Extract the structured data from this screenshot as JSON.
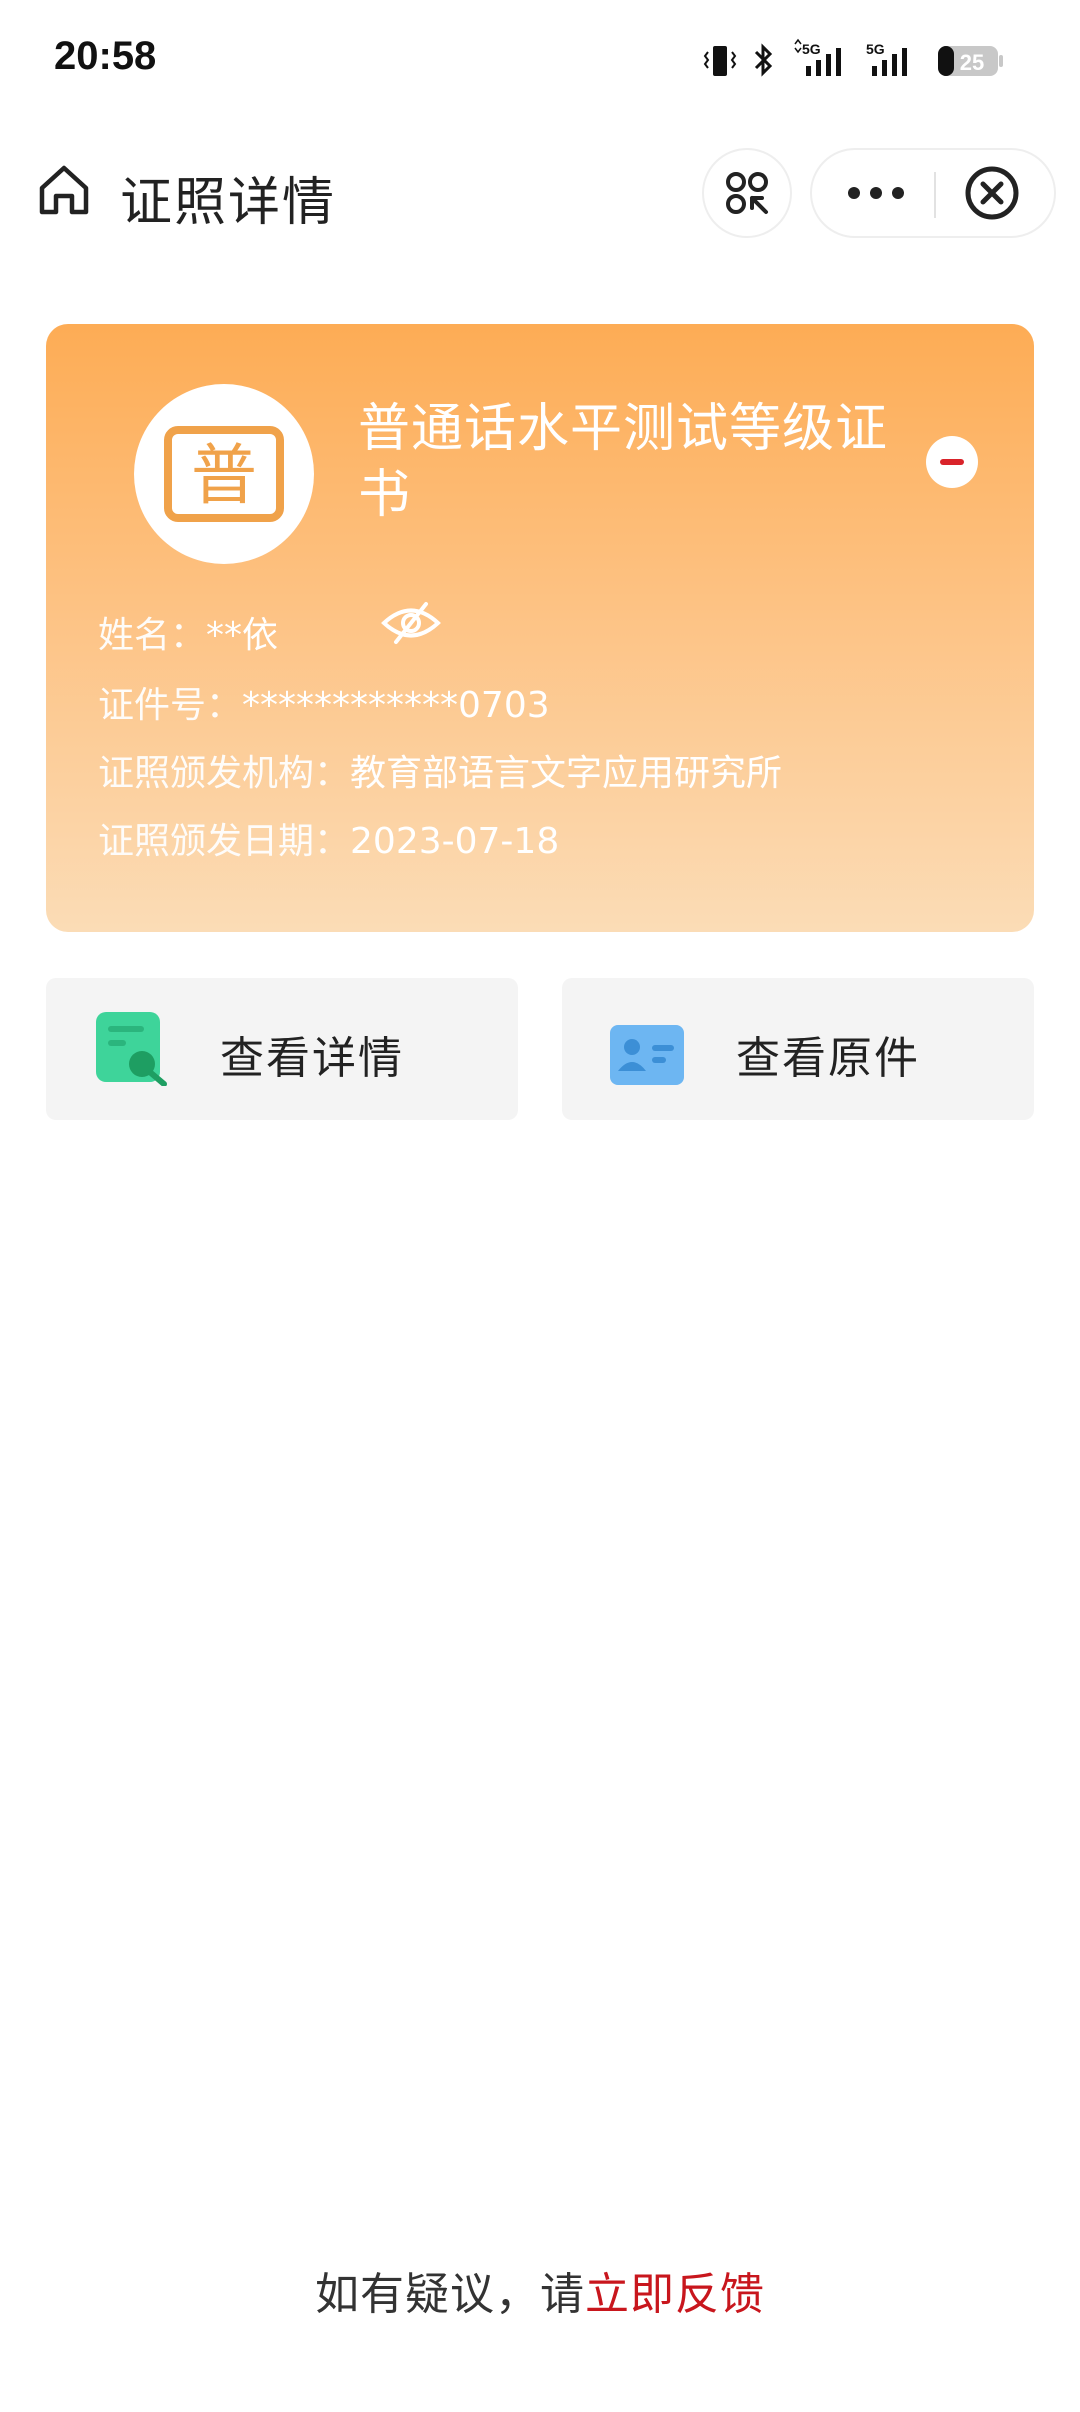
{
  "status_bar": {
    "time": "20:58",
    "network_1": "5G",
    "network_2": "5G",
    "battery": "25"
  },
  "nav": {
    "title": "证照详情",
    "icons": [
      "home-icon",
      "scan-icon",
      "more-icon",
      "close-icon"
    ]
  },
  "card": {
    "logo_char": "普",
    "title": "普通话水平测试等级证书",
    "rows": [
      {
        "label": "姓名：",
        "value": "**依"
      },
      {
        "label": "证件号：",
        "value": "************0703"
      },
      {
        "label": "证照颁发机构：",
        "value": "教育部语言文字应用研究所"
      },
      {
        "label": "证照颁发日期：",
        "value": "2023-07-18"
      }
    ],
    "colors": {
      "gradient_top": "#fdac55",
      "gradient_bottom": "#fbdcb6"
    }
  },
  "actions": {
    "details_label": "查看详情",
    "original_label": "查看原件"
  },
  "footer": {
    "prefix": "如有疑议，请",
    "link": "立即反馈",
    "link_color": "#c8161d"
  }
}
